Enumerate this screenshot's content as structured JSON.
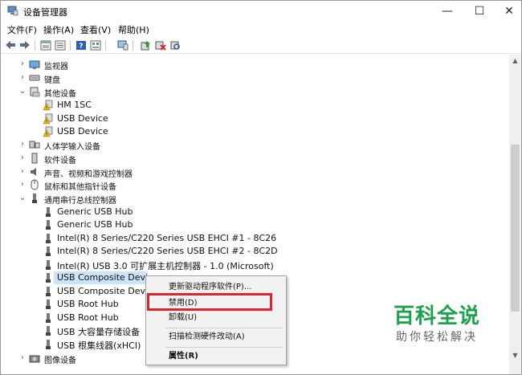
{
  "window": {
    "title": "设备管理器",
    "minimize": "—",
    "maximize": "☐",
    "close": "✕"
  },
  "menu": [
    "文件(F)",
    "操作(A)",
    "查看(V)",
    "帮助(H)"
  ],
  "toolbar_icons": [
    "back-icon",
    "forward-icon",
    "properties-icon",
    "list-icon",
    "help-icon",
    "details-icon",
    "monitor-icon",
    "update-driver-icon",
    "uninstall-icon",
    "scan-icon"
  ],
  "tree": {
    "monitors": "监视器",
    "keyboards": "键盘",
    "other_devices": "其他设备",
    "other": [
      "HM 1SC",
      "USB Device",
      "USB Device"
    ],
    "hid": "人体学输入设备",
    "software_devices": "软件设备",
    "audio": "声音、视频和游戏控制器",
    "mice": "鼠标和其他指针设备",
    "usb_controllers": "通用串行总线控制器",
    "usb": [
      "Generic USB Hub",
      "Generic USB Hub",
      "Intel(R) 8 Series/C220 Series USB EHCI #1 - 8C26",
      "Intel(R) 8 Series/C220 Series USB EHCI #2 - 8C2D",
      "Intel(R) USB 3.0 可扩展主机控制器 - 1.0 (Microsoft)",
      "USB Composite Device",
      "USB Composite Device",
      "USB Root Hub",
      "USB Root Hub",
      "USB 大容量存储设备",
      "USB 根集线器(xHCI)"
    ],
    "imaging": "图像设备"
  },
  "context_menu": {
    "update_driver": "更新驱动程序软件(P)...",
    "disable": "禁用(D)",
    "uninstall": "卸载(U)",
    "scan": "扫描检测硬件改动(A)",
    "properties": "属性(R)"
  },
  "watermark": {
    "title": "百科全说",
    "subtitle": "助你轻松解决"
  },
  "colors": {
    "selection": "#cce4f7",
    "highlight_box": "#e0242a",
    "watermark_green": "#1aa34a"
  }
}
